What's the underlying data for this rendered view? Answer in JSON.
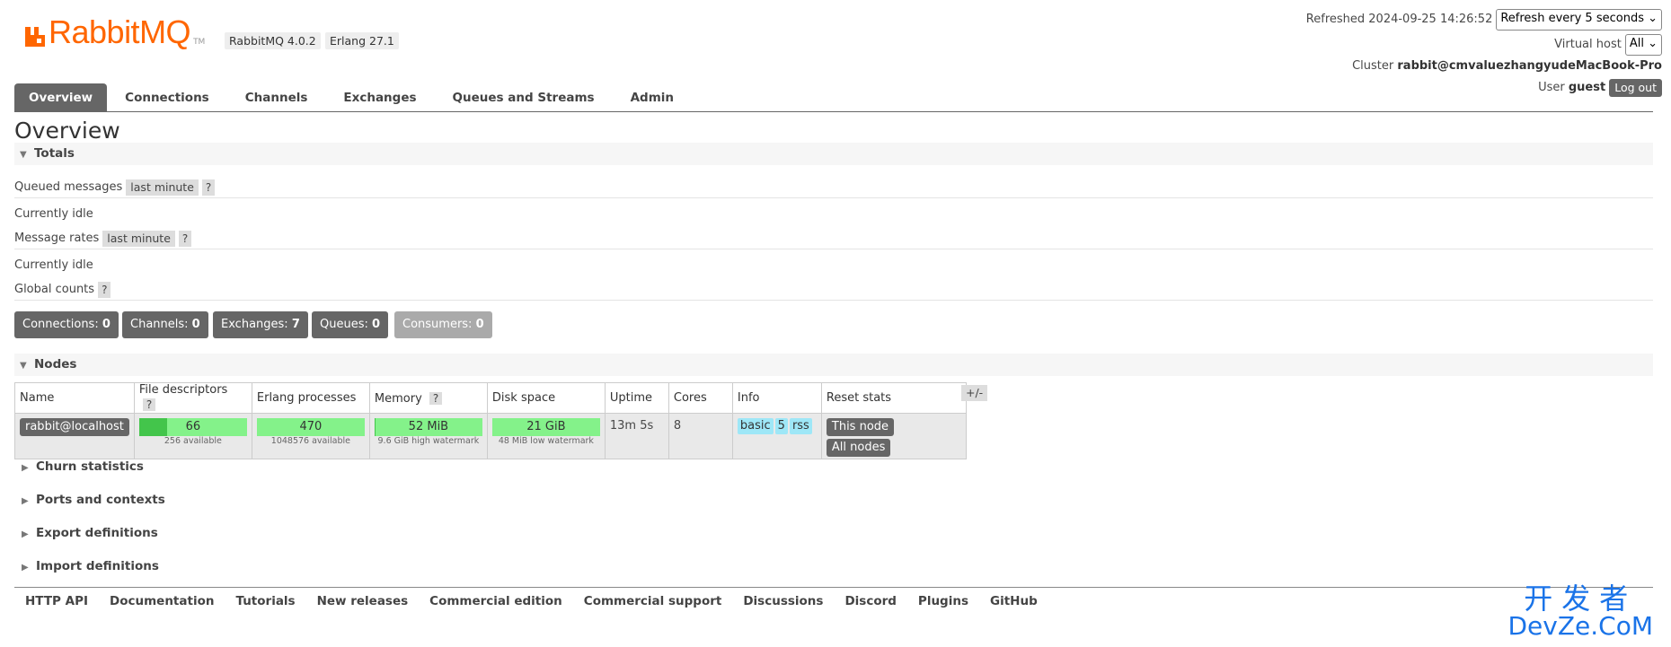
{
  "header": {
    "logo_text": "RabbitMQ",
    "tm": "TM",
    "version": "RabbitMQ 4.0.2",
    "erlang": "Erlang 27.1",
    "refreshed_label": "Refreshed 2024-09-25 14:26:52",
    "refresh_select": "Refresh every 5 seconds",
    "vhost_label": "Virtual host",
    "vhost_select": "All",
    "cluster_label": "Cluster",
    "cluster_name": "rabbit@cmvaluezhangyudeMacBook-Pro",
    "user_label": "User",
    "user_name": "guest",
    "logout_label": "Log out"
  },
  "tabs": [
    "Overview",
    "Connections",
    "Channels",
    "Exchanges",
    "Queues and Streams",
    "Admin"
  ],
  "page_title": "Overview",
  "totals": {
    "title": "Totals",
    "queued_label": "Queued messages",
    "queued_range": "last minute",
    "help": "?",
    "idle1": "Currently idle",
    "rates_label": "Message rates",
    "rates_range": "last minute",
    "idle2": "Currently idle",
    "global_label": "Global counts"
  },
  "counts": [
    {
      "label": "Connections:",
      "value": "0"
    },
    {
      "label": "Channels:",
      "value": "0"
    },
    {
      "label": "Exchanges:",
      "value": "7"
    },
    {
      "label": "Queues:",
      "value": "0"
    },
    {
      "label": "Consumers:",
      "value": "0"
    }
  ],
  "nodes": {
    "title": "Nodes",
    "headers": [
      "Name",
      "File descriptors",
      "Erlang processes",
      "Memory",
      "Disk space",
      "Uptime",
      "Cores",
      "Info",
      "Reset stats"
    ],
    "plus_minus": "+/-",
    "row": {
      "name": "rabbit@localhost",
      "fd_value": "66",
      "fd_sub": "256 available",
      "fd_fraction": 0.258,
      "erl_value": "470",
      "erl_sub": "1048576 available",
      "erl_fraction": 0.0004,
      "mem_value": "52 MiB",
      "mem_sub": "9.6 GiB high watermark",
      "mem_fraction": 0.005,
      "disk_value": "21 GiB",
      "disk_sub": "48 MiB low watermark",
      "disk_fraction": 0.0,
      "uptime": "13m 5s",
      "cores": "8",
      "info_tags": [
        "basic",
        "5",
        "rss"
      ],
      "reset_this": "This node",
      "reset_all": "All nodes"
    }
  },
  "collapsed_sections": [
    "Churn statistics",
    "Ports and contexts",
    "Export definitions",
    "Import definitions"
  ],
  "footer_links": [
    "HTTP API",
    "Documentation",
    "Tutorials",
    "New releases",
    "Commercial edition",
    "Commercial support",
    "Discussions",
    "Discord",
    "Plugins",
    "GitHub"
  ],
  "watermark": {
    "cn": "开发者",
    "en": "DevZe.CoM"
  },
  "colors": {
    "brand": "#ff6600",
    "bar_green": "#84f28a",
    "bar_fill": "#43c54b",
    "info_tag": "#9ee7f7"
  }
}
